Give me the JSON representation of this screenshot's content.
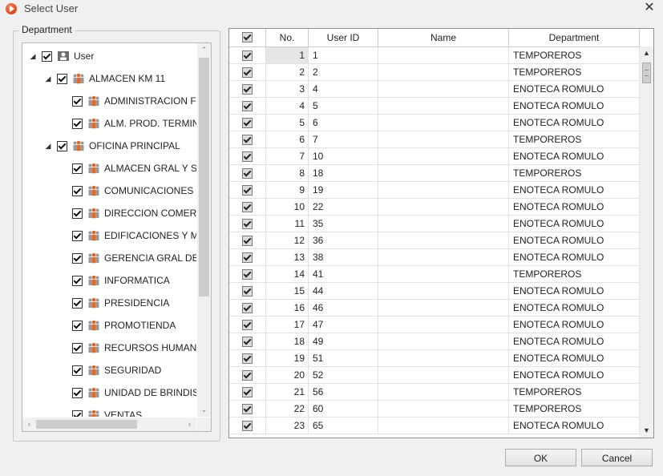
{
  "window": {
    "title": "Select User"
  },
  "department_panel": {
    "label": "Department",
    "tree": [
      {
        "label": "User",
        "level": 0,
        "expanded": true,
        "checked": true,
        "icon": "user-icon"
      },
      {
        "label": "ALMACEN KM 11",
        "level": 1,
        "expanded": true,
        "checked": true,
        "icon": "group-icon"
      },
      {
        "label": "ADMINISTRACION F",
        "level": 2,
        "checked": true,
        "icon": "group-icon"
      },
      {
        "label": "ALM. PROD. TERMIN",
        "level": 2,
        "checked": true,
        "icon": "group-icon"
      },
      {
        "label": "OFICINA PRINCIPAL",
        "level": 1,
        "expanded": true,
        "checked": true,
        "icon": "group-icon"
      },
      {
        "label": "ALMACEN GRAL Y SU",
        "level": 2,
        "checked": true,
        "icon": "group-icon"
      },
      {
        "label": "COMUNICACIONES",
        "level": 2,
        "checked": true,
        "icon": "group-icon"
      },
      {
        "label": "DIRECCION COMERC",
        "level": 2,
        "checked": true,
        "icon": "group-icon"
      },
      {
        "label": "EDIFICACIONES Y M",
        "level": 2,
        "checked": true,
        "icon": "group-icon"
      },
      {
        "label": "GERENCIA GRAL DES",
        "level": 2,
        "checked": true,
        "icon": "group-icon"
      },
      {
        "label": "INFORMATICA",
        "level": 2,
        "checked": true,
        "icon": "group-icon"
      },
      {
        "label": "PRESIDENCIA",
        "level": 2,
        "checked": true,
        "icon": "group-icon"
      },
      {
        "label": "PROMOTIENDA",
        "level": 2,
        "checked": true,
        "icon": "group-icon"
      },
      {
        "label": "RECURSOS HUMANC",
        "level": 2,
        "checked": true,
        "icon": "group-icon"
      },
      {
        "label": "SEGURIDAD",
        "level": 2,
        "checked": true,
        "icon": "group-icon"
      },
      {
        "label": "UNIDAD DE BRINDIS",
        "level": 2,
        "checked": true,
        "icon": "group-icon"
      },
      {
        "label": "VENTAS",
        "level": 2,
        "checked": true,
        "icon": "group-icon"
      }
    ]
  },
  "grid": {
    "columns": [
      "No.",
      "User ID",
      "Name",
      "Department"
    ],
    "rows": [
      {
        "no": "1",
        "user_id": "1",
        "name": "",
        "department": "TEMPOREROS",
        "checked": true
      },
      {
        "no": "2",
        "user_id": "2",
        "name": "",
        "department": "TEMPOREROS",
        "checked": true
      },
      {
        "no": "3",
        "user_id": "4",
        "name": "",
        "department": "ENOTECA ROMULO",
        "checked": true
      },
      {
        "no": "4",
        "user_id": "5",
        "name": "",
        "department": "ENOTECA ROMULO",
        "checked": true
      },
      {
        "no": "5",
        "user_id": "6",
        "name": "",
        "department": "ENOTECA ROMULO",
        "checked": true
      },
      {
        "no": "6",
        "user_id": "7",
        "name": "",
        "department": "TEMPOREROS",
        "checked": true
      },
      {
        "no": "7",
        "user_id": "10",
        "name": "",
        "department": "ENOTECA ROMULO",
        "checked": true
      },
      {
        "no": "8",
        "user_id": "18",
        "name": "",
        "department": "TEMPOREROS",
        "checked": true
      },
      {
        "no": "9",
        "user_id": "19",
        "name": "",
        "department": "ENOTECA ROMULO",
        "checked": true
      },
      {
        "no": "10",
        "user_id": "22",
        "name": "",
        "department": "ENOTECA ROMULO",
        "checked": true
      },
      {
        "no": "11",
        "user_id": "35",
        "name": "",
        "department": "ENOTECA ROMULO",
        "checked": true
      },
      {
        "no": "12",
        "user_id": "36",
        "name": "",
        "department": "ENOTECA ROMULO",
        "checked": true
      },
      {
        "no": "13",
        "user_id": "38",
        "name": "",
        "department": "ENOTECA ROMULO",
        "checked": true
      },
      {
        "no": "14",
        "user_id": "41",
        "name": "",
        "department": "TEMPOREROS",
        "checked": true
      },
      {
        "no": "15",
        "user_id": "44",
        "name": "",
        "department": "ENOTECA ROMULO",
        "checked": true
      },
      {
        "no": "16",
        "user_id": "46",
        "name": "",
        "department": "ENOTECA ROMULO",
        "checked": true
      },
      {
        "no": "17",
        "user_id": "47",
        "name": "",
        "department": "ENOTECA ROMULO",
        "checked": true
      },
      {
        "no": "18",
        "user_id": "49",
        "name": "",
        "department": "ENOTECA ROMULO",
        "checked": true
      },
      {
        "no": "19",
        "user_id": "51",
        "name": "",
        "department": "ENOTECA ROMULO",
        "checked": true
      },
      {
        "no": "20",
        "user_id": "52",
        "name": "",
        "department": "ENOTECA ROMULO",
        "checked": true
      },
      {
        "no": "21",
        "user_id": "56",
        "name": "",
        "department": "TEMPOREROS",
        "checked": true
      },
      {
        "no": "22",
        "user_id": "60",
        "name": "",
        "department": "TEMPOREROS",
        "checked": true
      },
      {
        "no": "23",
        "user_id": "65",
        "name": "",
        "department": "ENOTECA ROMULO",
        "checked": true
      }
    ]
  },
  "buttons": {
    "ok": "OK",
    "cancel": "Cancel"
  }
}
